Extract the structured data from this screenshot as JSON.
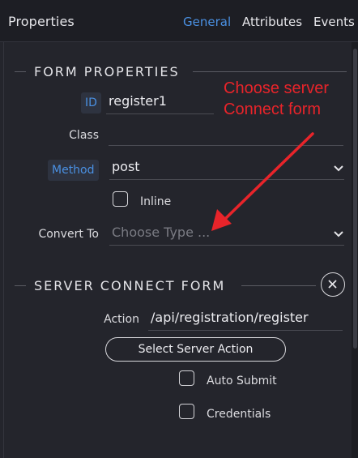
{
  "header": {
    "title": "Properties",
    "tabs": [
      {
        "label": "General",
        "active": true
      },
      {
        "label": "Attributes",
        "active": false
      },
      {
        "label": "Events",
        "active": false
      }
    ]
  },
  "form_properties": {
    "section_title": "FORM PROPERTIES",
    "id_label": "ID",
    "id_value": "register1",
    "class_label": "Class",
    "class_value": "",
    "method_label": "Method",
    "method_value": "post",
    "inline_label": "Inline",
    "inline_checked": false,
    "convert_label": "Convert To",
    "convert_placeholder": "Choose Type ..."
  },
  "server_connect": {
    "section_title": "SERVER CONNECT FORM",
    "action_label": "Action",
    "action_value": "/api/registration/register",
    "select_button": "Select Server Action",
    "auto_submit_label": "Auto Submit",
    "auto_submit_checked": false,
    "credentials_label": "Credentials",
    "credentials_checked": false
  },
  "annotation": {
    "line1": "Choose server",
    "line2": "Connect form",
    "color": "#e8242a"
  },
  "colors": {
    "accent": "#4a90e2",
    "background": "#24252c",
    "header_background": "#1d1e24"
  }
}
